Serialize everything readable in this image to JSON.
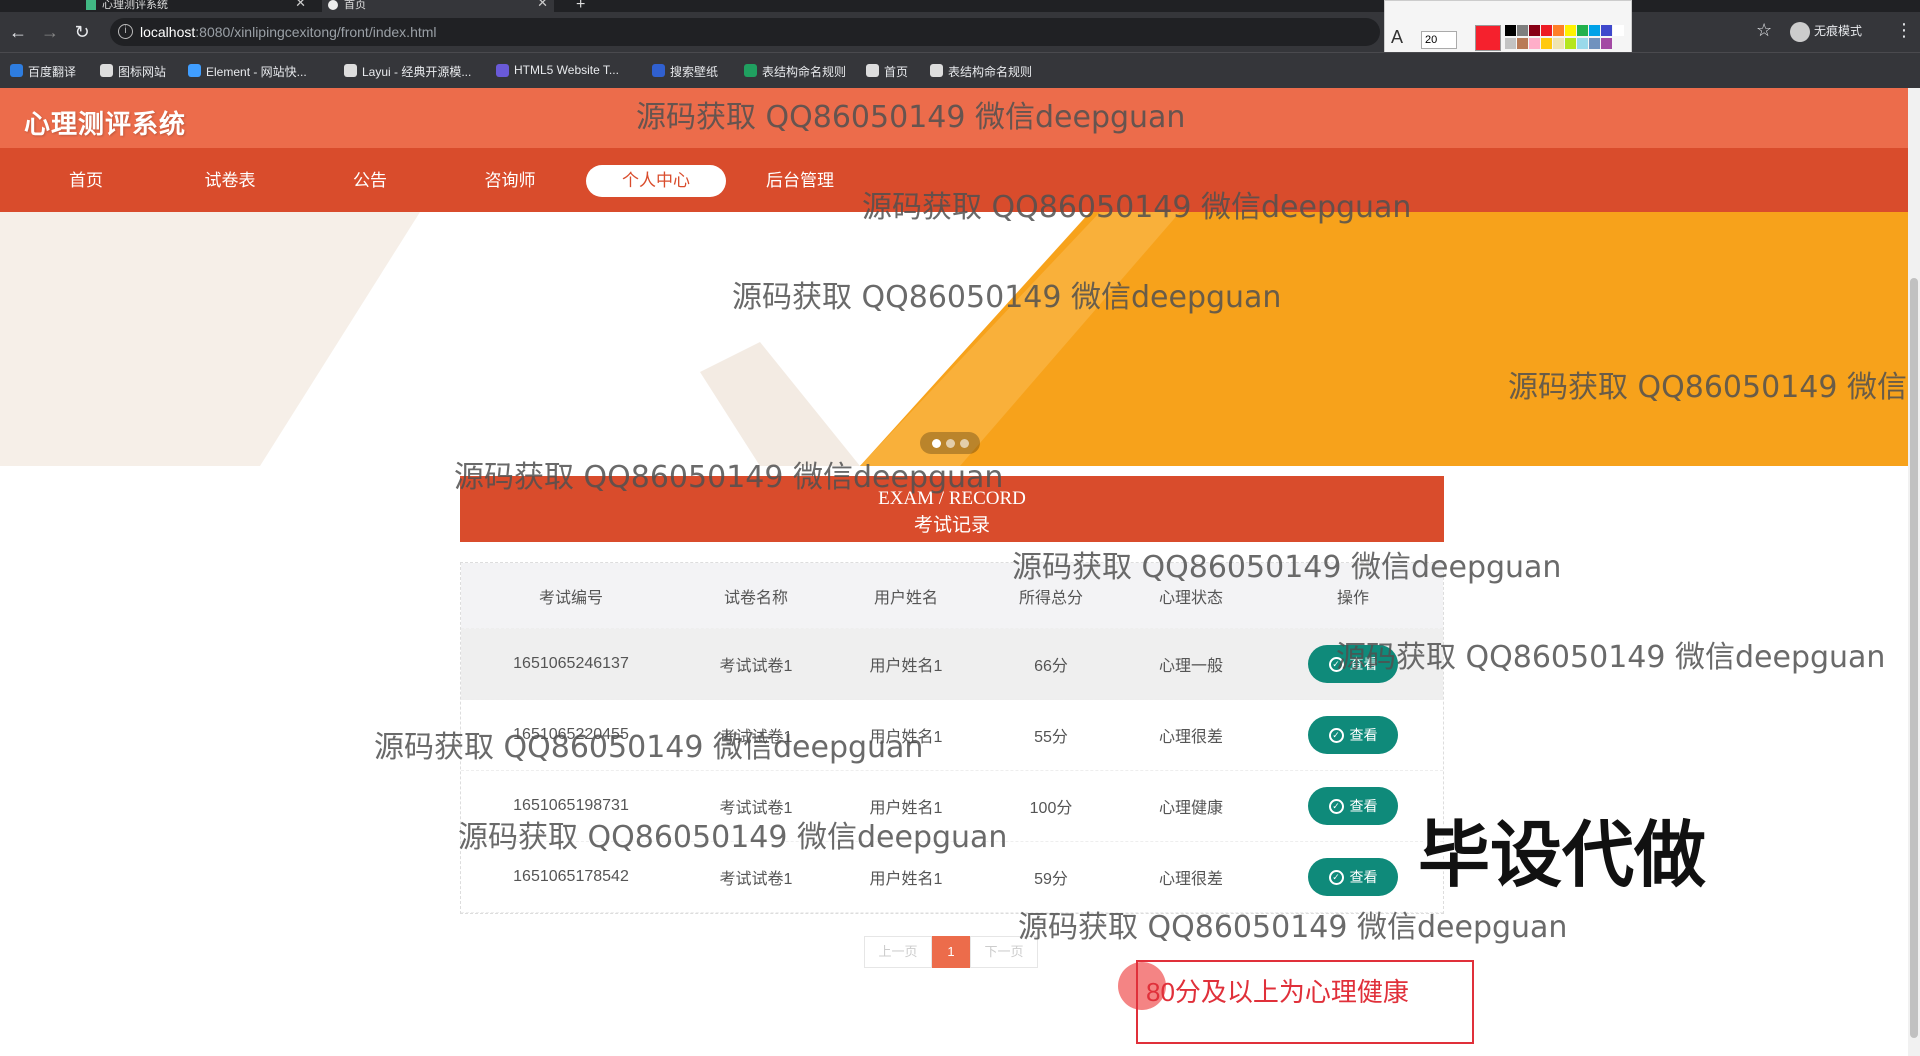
{
  "browser": {
    "tabs": [
      {
        "label": "心理测评系统",
        "active": false
      },
      {
        "label": "首页",
        "active": true
      }
    ],
    "url_host": "localhost",
    "url_rest": ":8080/xinlipingcexitong/front/index.html",
    "incognito_label": "无痕模式",
    "bookmarks": [
      {
        "label": "百度翻译",
        "color": "#2e7de0"
      },
      {
        "label": "图标网站",
        "color": "#dddddd"
      },
      {
        "label": "Element - 网站快...",
        "color": "#409eff"
      },
      {
        "label": "Layui - 经典开源模...",
        "color": "#dddddd"
      },
      {
        "label": "HTML5 Website T...",
        "color": "#6a5ad8"
      },
      {
        "label": "搜索壁纸",
        "color": "#3060d0"
      },
      {
        "label": "表结构命名规则",
        "color": "#20a060"
      },
      {
        "label": "首页",
        "color": "#dddddd"
      },
      {
        "label": "表结构命名规则",
        "color": "#dddddd"
      }
    ],
    "palette_font_size": "20",
    "palette_colors": [
      "#000000",
      "#7f7f7f",
      "#880015",
      "#ed1c24",
      "#ff7f27",
      "#fff200",
      "#22b14c",
      "#00a2e8",
      "#3f48cc",
      "#ffffff",
      "#c3c3c3",
      "#b97a57",
      "#ffaec9",
      "#ffc90e",
      "#efe4b0",
      "#b5e61d",
      "#99d9ea",
      "#7092be",
      "#a349a4"
    ]
  },
  "site": {
    "logo": "心理测评系统",
    "nav": [
      {
        "label": "首页",
        "active": false
      },
      {
        "label": "试卷表",
        "active": false
      },
      {
        "label": "公告",
        "active": false
      },
      {
        "label": "咨询师",
        "active": false
      },
      {
        "label": "个人中心",
        "active": true
      },
      {
        "label": "后台管理",
        "active": false
      }
    ],
    "colors": {
      "header": "#ec6c4b",
      "nav": "#d94c2c",
      "banner_orange": "#f7a21b",
      "action": "#0f8a7a"
    }
  },
  "records": {
    "title_en": "EXAM / RECORD",
    "title_cn": "考试记录",
    "columns": [
      "考试编号",
      "试卷名称",
      "用户姓名",
      "所得总分",
      "心理状态",
      "操作"
    ],
    "rows": [
      {
        "id": "1651065246137",
        "paper": "考试试卷1",
        "user": "用户姓名1",
        "score": "66分",
        "status": "心理一般",
        "action": "查看"
      },
      {
        "id": "1651065220455",
        "paper": "考试试卷1",
        "user": "用户姓名1",
        "score": "55分",
        "status": "心理很差",
        "action": "查看"
      },
      {
        "id": "1651065198731",
        "paper": "考试试卷1",
        "user": "用户姓名1",
        "score": "100分",
        "status": "心理健康",
        "action": "查看"
      },
      {
        "id": "1651065178542",
        "paper": "考试试卷1",
        "user": "用户姓名1",
        "score": "59分",
        "status": "心理很差",
        "action": "查看"
      }
    ]
  },
  "pagination": {
    "prev": "上一页",
    "current": "1",
    "next": "下一页"
  },
  "overlay": {
    "watermark": "源码获取 QQ86050149 微信deepguan",
    "big_label": "毕设代做",
    "note": "80分及以上为心理健康"
  }
}
